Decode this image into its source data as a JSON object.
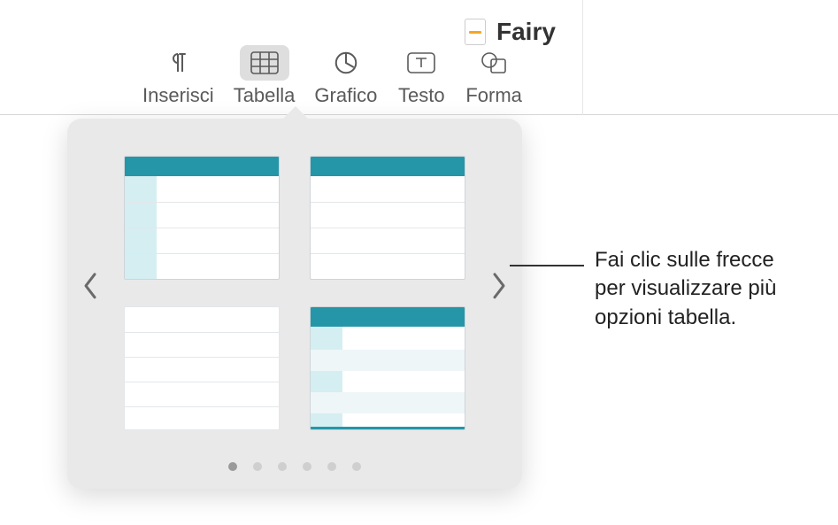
{
  "document": {
    "title": "Fairy"
  },
  "toolbar": {
    "items": [
      {
        "id": "inserisci",
        "label": "Inserisci",
        "icon": "pilcrow-icon"
      },
      {
        "id": "tabella",
        "label": "Tabella",
        "icon": "table-icon"
      },
      {
        "id": "grafico",
        "label": "Grafico",
        "icon": "piechart-icon"
      },
      {
        "id": "testo",
        "label": "Testo",
        "icon": "textbox-icon"
      },
      {
        "id": "forma",
        "label": "Forma",
        "icon": "shape-icon"
      }
    ],
    "active": "tabella"
  },
  "popover": {
    "styles": [
      {
        "id": "style1",
        "name": "table-style-header-firstcol"
      },
      {
        "id": "style2",
        "name": "table-style-header-only"
      },
      {
        "id": "style3",
        "name": "table-style-plain"
      },
      {
        "id": "style4",
        "name": "table-style-header-firstcol-alt"
      }
    ],
    "pages": {
      "count": 6,
      "active": 0
    }
  },
  "callout": {
    "line1": "Fai clic sulle frecce",
    "line2": "per visualizzare più",
    "line3": "opzioni tabella."
  },
  "colors": {
    "accent": "#2596a8",
    "accent_light": "#d5eef2",
    "panel": "#e9e9e9"
  }
}
